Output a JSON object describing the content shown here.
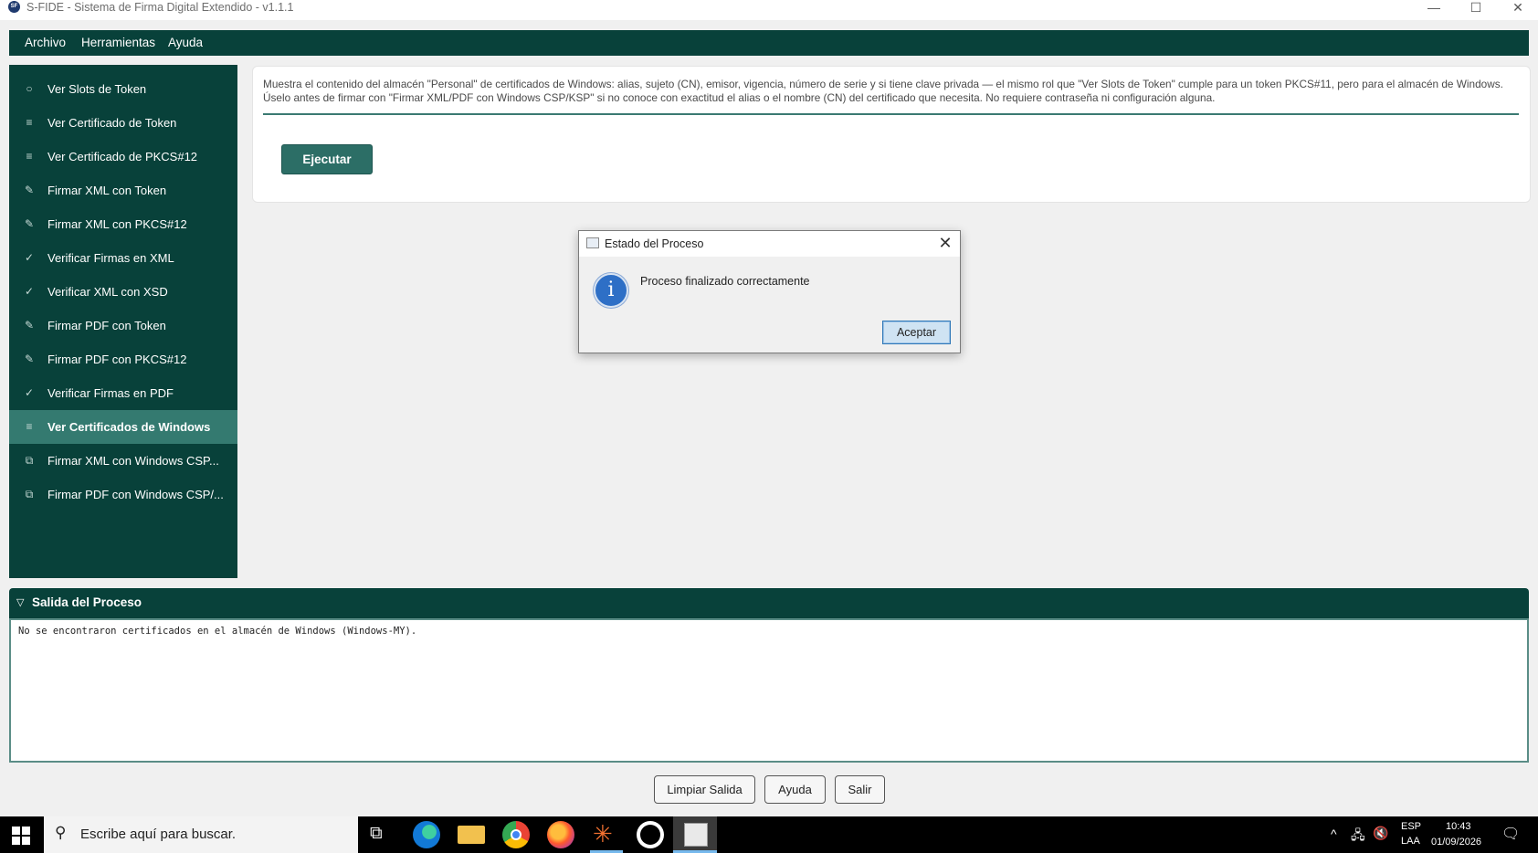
{
  "window": {
    "title": "S-FIDE - Sistema de Firma Digital Extendido - v1.1.1",
    "app_icon_text": "SF",
    "minimize": "—",
    "maximize": "☐",
    "close": "✕"
  },
  "menu": {
    "items": [
      "Archivo",
      "Herramientas",
      "Ayuda"
    ]
  },
  "sidebar": {
    "items": [
      {
        "icon": "○",
        "label": "Ver Slots de Token"
      },
      {
        "icon": "≡",
        "label": "Ver Certificado de Token"
      },
      {
        "icon": "≡",
        "label": "Ver Certificado de PKCS#12"
      },
      {
        "icon": "✎",
        "label": "Firmar XML con Token"
      },
      {
        "icon": "✎",
        "label": "Firmar XML con PKCS#12"
      },
      {
        "icon": "✓",
        "label": "Verificar Firmas en XML"
      },
      {
        "icon": "✓",
        "label": "Verificar XML con XSD"
      },
      {
        "icon": "✎",
        "label": "Firmar PDF con Token"
      },
      {
        "icon": "✎",
        "label": "Firmar PDF con PKCS#12"
      },
      {
        "icon": "✓",
        "label": "Verificar Firmas en PDF"
      },
      {
        "icon": "≡",
        "label": "Ver Certificados de Windows"
      },
      {
        "icon": "⧉",
        "label": "Firmar XML con Windows CSP..."
      },
      {
        "icon": "⧉",
        "label": "Firmar PDF con Windows CSP/..."
      }
    ],
    "active_index": 10
  },
  "panel": {
    "description_line1": "Muestra el contenido del almacén \"Personal\" de certificados de Windows: alias, sujeto (CN), emisor, vigencia, número de serie y si tiene clave privada — el mismo rol que \"Ver Slots de Token\" cumple para un token PKCS#11, pero para el almacén de Windows.",
    "description_line2": "Úselo antes de firmar con \"Firmar XML/PDF con Windows CSP/KSP\" si no conoce con exactitud el alias o el nombre (CN) del certificado que necesita. No requiere contraseña ni configuración alguna.",
    "execute_label": "Ejecutar"
  },
  "dialog": {
    "title": "Estado del Proceso",
    "message": "Proceso finalizado correctamente",
    "info_glyph": "i",
    "close_glyph": "✕",
    "accept_label": "Aceptar"
  },
  "output": {
    "title": "Salida del Proceso",
    "chevron": "▽",
    "text": "No se encontraron certificados en el almacén de Windows (Windows-MY)."
  },
  "buttons": {
    "clear": "Limpiar Salida",
    "help": "Ayuda",
    "exit": "Salir"
  },
  "taskbar": {
    "search_placeholder": "Escribe aquí para buscar.",
    "search_glyph": "⚲",
    "taskview_glyph": "⧉",
    "lang_top": "ESP",
    "lang_bottom": "LAA",
    "time": "10:43",
    "date": "01/09/2026",
    "tray_up": "^",
    "tray_network": "🖧",
    "tray_volume": "🔇",
    "notif_glyph": "🗨"
  },
  "colors": {
    "accent": "#08413a",
    "active": "#347a70",
    "button": "#2c6e66"
  }
}
